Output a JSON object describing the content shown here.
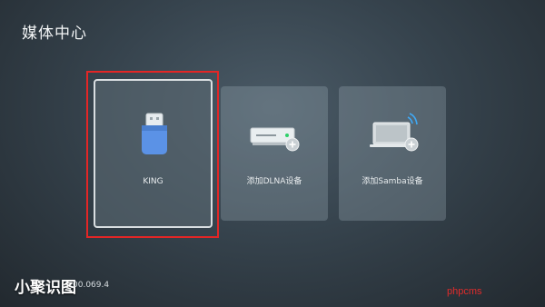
{
  "header": {
    "title": "媒体中心"
  },
  "devices": [
    {
      "label": "KING",
      "icon": "usb-drive-icon",
      "selected": true
    },
    {
      "label": "添加DLNA设备",
      "icon": "dlna-add-icon",
      "selected": false
    },
    {
      "label": "添加Samba设备",
      "icon": "samba-add-icon",
      "selected": false
    }
  ],
  "footer": {
    "watermark": "小聚识图",
    "version": "00.069.4",
    "brand": "phpcms"
  },
  "colors": {
    "focus": "#e32626",
    "usb": "#5b92e6"
  }
}
